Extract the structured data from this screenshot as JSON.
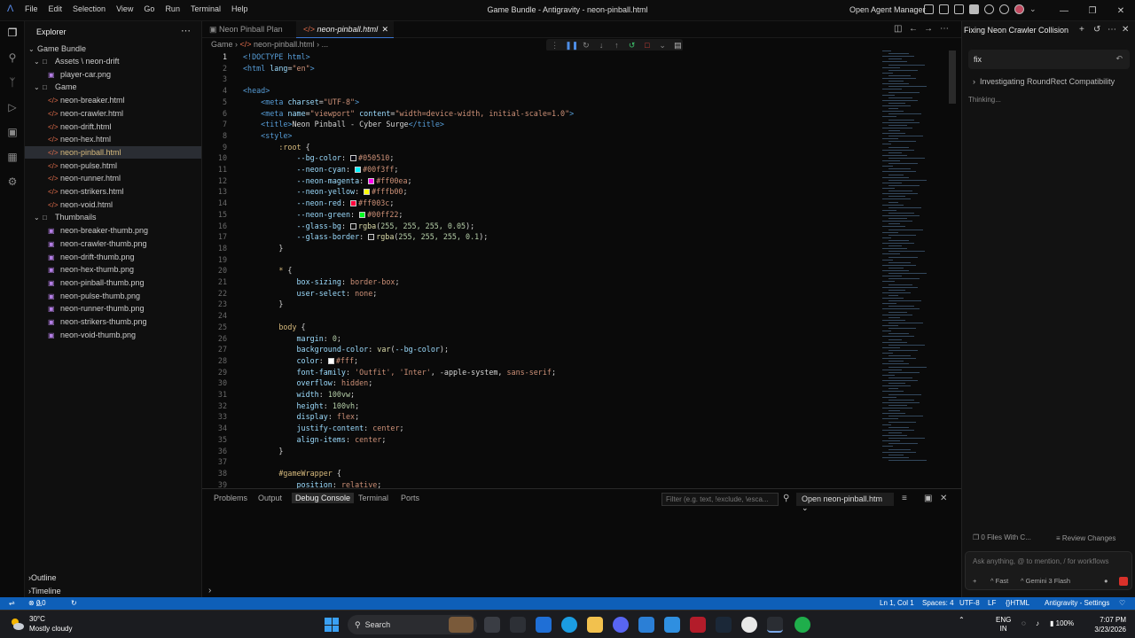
{
  "window": {
    "title": "Game Bundle - Antigravity - neon-pinball.html",
    "menus": [
      "File",
      "Edit",
      "Selection",
      "View",
      "Go",
      "Run",
      "Terminal",
      "Help"
    ],
    "open_agent_manager": "Open Agent Manager"
  },
  "explorer": {
    "header": "Explorer",
    "root": "Game Bundle",
    "tree": [
      {
        "label": "Assets \\ neon-drift",
        "kind": "folder",
        "depth": 1
      },
      {
        "label": "player-car.png",
        "kind": "image",
        "depth": 2
      },
      {
        "label": "Game",
        "kind": "folder",
        "depth": 1
      },
      {
        "label": "neon-breaker.html",
        "kind": "html",
        "depth": 2
      },
      {
        "label": "neon-crawler.html",
        "kind": "html",
        "depth": 2
      },
      {
        "label": "neon-drift.html",
        "kind": "html",
        "depth": 2
      },
      {
        "label": "neon-hex.html",
        "kind": "html",
        "depth": 2
      },
      {
        "label": "neon-pinball.html",
        "kind": "html",
        "depth": 2,
        "selected": true
      },
      {
        "label": "neon-pulse.html",
        "kind": "html",
        "depth": 2
      },
      {
        "label": "neon-runner.html",
        "kind": "html",
        "depth": 2
      },
      {
        "label": "neon-strikers.html",
        "kind": "html",
        "depth": 2
      },
      {
        "label": "neon-void.html",
        "kind": "html",
        "depth": 2
      },
      {
        "label": "Thumbnails",
        "kind": "folder",
        "depth": 1
      },
      {
        "label": "neon-breaker-thumb.png",
        "kind": "image",
        "depth": 2
      },
      {
        "label": "neon-crawler-thumb.png",
        "kind": "image",
        "depth": 2
      },
      {
        "label": "neon-drift-thumb.png",
        "kind": "image",
        "depth": 2
      },
      {
        "label": "neon-hex-thumb.png",
        "kind": "image",
        "depth": 2
      },
      {
        "label": "neon-pinball-thumb.png",
        "kind": "image",
        "depth": 2
      },
      {
        "label": "neon-pulse-thumb.png",
        "kind": "image",
        "depth": 2
      },
      {
        "label": "neon-runner-thumb.png",
        "kind": "image",
        "depth": 2
      },
      {
        "label": "neon-strikers-thumb.png",
        "kind": "image",
        "depth": 2
      },
      {
        "label": "neon-void-thumb.png",
        "kind": "image",
        "depth": 2
      }
    ],
    "outline": "Outline",
    "timeline": "Timeline"
  },
  "tabs": [
    {
      "label": "Neon Pinball Plan",
      "active": false
    },
    {
      "label": "neon-pinball.html",
      "active": true
    }
  ],
  "breadcrumb": [
    "Game",
    "neon-pinball.html",
    "..."
  ],
  "code": [
    {
      "n": 1,
      "t": [
        [
          "tag",
          "<!DOCTYPE html>"
        ]
      ]
    },
    {
      "n": 2,
      "t": [
        [
          "tag",
          "<html "
        ],
        [
          "attr",
          "lang"
        ],
        [
          "punc",
          "="
        ],
        [
          "str",
          "\"en\""
        ],
        [
          "tag",
          ">"
        ]
      ]
    },
    {
      "n": 3,
      "t": []
    },
    {
      "n": 4,
      "t": [
        [
          "tag",
          "<head>"
        ]
      ]
    },
    {
      "n": 5,
      "i": 1,
      "t": [
        [
          "tag",
          "<meta "
        ],
        [
          "attr",
          "charset"
        ],
        [
          "punc",
          "="
        ],
        [
          "str",
          "\"UTF-8\""
        ],
        [
          "tag",
          ">"
        ]
      ]
    },
    {
      "n": 6,
      "i": 1,
      "t": [
        [
          "tag",
          "<meta "
        ],
        [
          "attr",
          "name"
        ],
        [
          "punc",
          "="
        ],
        [
          "str",
          "\"viewport\" "
        ],
        [
          "attr",
          "content"
        ],
        [
          "punc",
          "="
        ],
        [
          "str",
          "\"width=device-width, initial-scale=1.0\""
        ],
        [
          "tag",
          ">"
        ]
      ]
    },
    {
      "n": 7,
      "i": 1,
      "t": [
        [
          "tag",
          "<title>"
        ],
        [
          "txt",
          "Neon Pinball - Cyber Surge"
        ],
        [
          "tag",
          "</title>"
        ]
      ]
    },
    {
      "n": 8,
      "i": 1,
      "t": [
        [
          "tag",
          "<style>"
        ]
      ]
    },
    {
      "n": 9,
      "i": 2,
      "t": [
        [
          "sel",
          ":root"
        ],
        [
          "punc",
          " {"
        ]
      ]
    },
    {
      "n": 10,
      "i": 3,
      "t": [
        [
          "prop",
          "--bg-color"
        ],
        [
          "punc",
          ": "
        ],
        [
          "sw",
          "#050510"
        ],
        [
          "val",
          "#050510"
        ],
        [
          "punc",
          ";"
        ]
      ]
    },
    {
      "n": 11,
      "i": 3,
      "t": [
        [
          "prop",
          "--neon-cyan"
        ],
        [
          "punc",
          ": "
        ],
        [
          "sw",
          "#00f3ff"
        ],
        [
          "val",
          "#00f3ff"
        ],
        [
          "punc",
          ";"
        ]
      ]
    },
    {
      "n": 12,
      "i": 3,
      "t": [
        [
          "prop",
          "--neon-magenta"
        ],
        [
          "punc",
          ": "
        ],
        [
          "sw",
          "#ff00ea"
        ],
        [
          "val",
          "#ff00ea"
        ],
        [
          "punc",
          ";"
        ]
      ]
    },
    {
      "n": 13,
      "i": 3,
      "t": [
        [
          "prop",
          "--neon-yellow"
        ],
        [
          "punc",
          ": "
        ],
        [
          "sw",
          "#fffb00"
        ],
        [
          "val",
          "#fffb00"
        ],
        [
          "punc",
          ";"
        ]
      ]
    },
    {
      "n": 14,
      "i": 3,
      "t": [
        [
          "prop",
          "--neon-red"
        ],
        [
          "punc",
          ": "
        ],
        [
          "sw",
          "#ff003c"
        ],
        [
          "val",
          "#ff003c"
        ],
        [
          "punc",
          ";"
        ]
      ]
    },
    {
      "n": 15,
      "i": 3,
      "t": [
        [
          "prop",
          "--neon-green"
        ],
        [
          "punc",
          ": "
        ],
        [
          "sw",
          "#00ff22"
        ],
        [
          "val",
          "#00ff22"
        ],
        [
          "punc",
          ";"
        ]
      ]
    },
    {
      "n": 16,
      "i": 3,
      "t": [
        [
          "prop",
          "--glass-bg"
        ],
        [
          "punc",
          ": "
        ],
        [
          "sw",
          "#0d0d0d"
        ],
        [
          "fn",
          "rgba"
        ],
        [
          "punc",
          "("
        ],
        [
          "num",
          "255, 255, 255, 0.05"
        ],
        [
          "punc",
          ");"
        ]
      ]
    },
    {
      "n": 17,
      "i": 3,
      "t": [
        [
          "prop",
          "--glass-border"
        ],
        [
          "punc",
          ": "
        ],
        [
          "sw",
          "#1a1a1a"
        ],
        [
          "fn",
          "rgba"
        ],
        [
          "punc",
          "("
        ],
        [
          "num",
          "255, 255, 255, 0.1"
        ],
        [
          "punc",
          ");"
        ]
      ]
    },
    {
      "n": 18,
      "i": 2,
      "t": [
        [
          "punc",
          "}"
        ]
      ]
    },
    {
      "n": 19,
      "t": []
    },
    {
      "n": 20,
      "i": 2,
      "t": [
        [
          "sel",
          "*"
        ],
        [
          "punc",
          " {"
        ]
      ]
    },
    {
      "n": 21,
      "i": 3,
      "t": [
        [
          "prop",
          "box-sizing"
        ],
        [
          "punc",
          ": "
        ],
        [
          "val",
          "border-box"
        ],
        [
          "punc",
          ";"
        ]
      ]
    },
    {
      "n": 22,
      "i": 3,
      "t": [
        [
          "prop",
          "user-select"
        ],
        [
          "punc",
          ": "
        ],
        [
          "val",
          "none"
        ],
        [
          "punc",
          ";"
        ]
      ]
    },
    {
      "n": 23,
      "i": 2,
      "t": [
        [
          "punc",
          "}"
        ]
      ]
    },
    {
      "n": 24,
      "t": []
    },
    {
      "n": 25,
      "i": 2,
      "t": [
        [
          "sel",
          "body"
        ],
        [
          "punc",
          " {"
        ]
      ]
    },
    {
      "n": 26,
      "i": 3,
      "t": [
        [
          "prop",
          "margin"
        ],
        [
          "punc",
          ": "
        ],
        [
          "num",
          "0"
        ],
        [
          "punc",
          ";"
        ]
      ]
    },
    {
      "n": 27,
      "i": 3,
      "t": [
        [
          "prop",
          "background-color"
        ],
        [
          "punc",
          ": "
        ],
        [
          "fn",
          "var"
        ],
        [
          "punc",
          "("
        ],
        [
          "prop",
          "--bg-color"
        ],
        [
          "punc",
          ");"
        ]
      ]
    },
    {
      "n": 28,
      "i": 3,
      "t": [
        [
          "prop",
          "color"
        ],
        [
          "punc",
          ": "
        ],
        [
          "sw",
          "#ffffff"
        ],
        [
          "val",
          "#fff"
        ],
        [
          "punc",
          ";"
        ]
      ]
    },
    {
      "n": 29,
      "i": 3,
      "t": [
        [
          "prop",
          "font-family"
        ],
        [
          "punc",
          ": "
        ],
        [
          "val",
          "'Outfit', 'Inter'"
        ],
        [
          "punc",
          ", -apple-system, "
        ],
        [
          "val",
          "sans-serif"
        ],
        [
          "punc",
          ";"
        ]
      ]
    },
    {
      "n": 30,
      "i": 3,
      "t": [
        [
          "prop",
          "overflow"
        ],
        [
          "punc",
          ": "
        ],
        [
          "val",
          "hidden"
        ],
        [
          "punc",
          ";"
        ]
      ]
    },
    {
      "n": 31,
      "i": 3,
      "t": [
        [
          "prop",
          "width"
        ],
        [
          "punc",
          ": "
        ],
        [
          "num",
          "100vw"
        ],
        [
          "punc",
          ";"
        ]
      ]
    },
    {
      "n": 32,
      "i": 3,
      "t": [
        [
          "prop",
          "height"
        ],
        [
          "punc",
          ": "
        ],
        [
          "num",
          "100vh"
        ],
        [
          "punc",
          ";"
        ]
      ]
    },
    {
      "n": 33,
      "i": 3,
      "t": [
        [
          "prop",
          "display"
        ],
        [
          "punc",
          ": "
        ],
        [
          "val",
          "flex"
        ],
        [
          "punc",
          ";"
        ]
      ]
    },
    {
      "n": 34,
      "i": 3,
      "t": [
        [
          "prop",
          "justify-content"
        ],
        [
          "punc",
          ": "
        ],
        [
          "val",
          "center"
        ],
        [
          "punc",
          ";"
        ]
      ]
    },
    {
      "n": 35,
      "i": 3,
      "t": [
        [
          "prop",
          "align-items"
        ],
        [
          "punc",
          ": "
        ],
        [
          "val",
          "center"
        ],
        [
          "punc",
          ";"
        ]
      ]
    },
    {
      "n": 36,
      "i": 2,
      "t": [
        [
          "punc",
          "}"
        ]
      ]
    },
    {
      "n": 37,
      "t": []
    },
    {
      "n": 38,
      "i": 2,
      "t": [
        [
          "sel",
          "#gameWrapper"
        ],
        [
          "punc",
          " {"
        ]
      ]
    },
    {
      "n": 39,
      "i": 3,
      "t": [
        [
          "prop",
          "position"
        ],
        [
          "punc",
          ": "
        ],
        [
          "val",
          "relative"
        ],
        [
          "punc",
          ";"
        ]
      ]
    }
  ],
  "panel": {
    "tabs": [
      "Problems",
      "Output",
      "Debug Console",
      "Terminal",
      "Ports"
    ],
    "active_tab": "Debug Console",
    "filter_placeholder": "Filter (e.g. text, !exclude, \\esca...",
    "open_file": "Open neon-pinball.htm"
  },
  "agent": {
    "title": "Fixing Neon Crawler Collision",
    "prompt": "fix",
    "step": "Investigating RoundRect Compatibility",
    "status": "Thinking...",
    "files": "0 Files With C...",
    "review": "Review Changes",
    "ask_placeholder": "Ask anything, @ to mention, / for workflows",
    "mode": "Fast",
    "model": "Gemini 3 Flash"
  },
  "status": {
    "errors": "0",
    "warnings": "0",
    "position": "Ln 1, Col 1",
    "spaces": "Spaces: 4",
    "encoding": "UTF-8",
    "eol": "LF",
    "language": "HTML",
    "settings": "Antigravity - Settings"
  },
  "taskbar": {
    "temp": "30°C",
    "weather": "Mostly cloudy",
    "search": "Search",
    "lang1": "ENG",
    "lang2": "IN",
    "battery": "100%",
    "time": "7:07 PM",
    "date": "3/23/2026"
  }
}
